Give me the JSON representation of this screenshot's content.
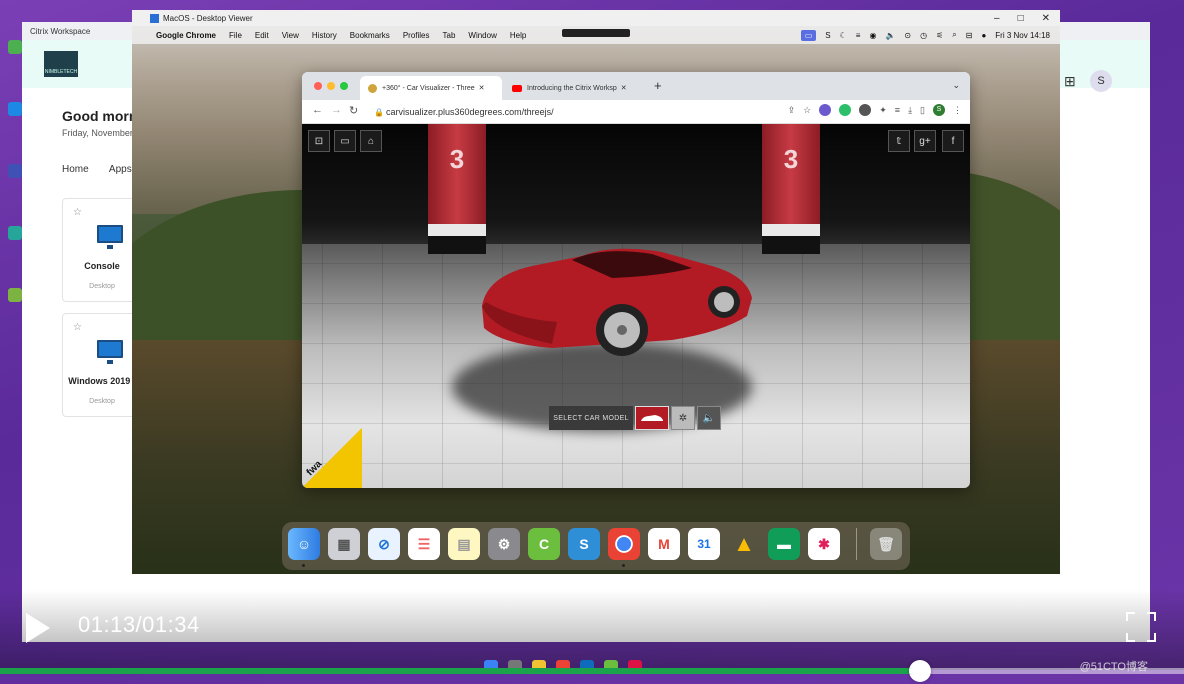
{
  "citrix": {
    "title": "Citrix Workspace",
    "greeting": "Good morn",
    "date": "Friday, November",
    "nav": [
      "Home",
      "Apps"
    ],
    "avatar": "S",
    "logo": "NIMBLETECH",
    "cards": [
      {
        "title": "Console",
        "sub": "Desktop"
      },
      {
        "title": "Windows 2019 -",
        "sub": "Desktop"
      }
    ]
  },
  "viewer": {
    "title": "MacOS - Desktop Viewer",
    "controls": [
      "–",
      "□",
      "✕"
    ]
  },
  "menubar": {
    "app": "Google Chrome",
    "items": [
      "File",
      "Edit",
      "View",
      "History",
      "Bookmarks",
      "Profiles",
      "Tab",
      "Window",
      "Help"
    ],
    "clock": "Fri 3 Nov  14:18"
  },
  "chrome": {
    "tabs": [
      {
        "label": "+360° - Car Visualizer - Three",
        "active": true
      },
      {
        "label": "Introducing the Citrix Worksp",
        "active": false
      }
    ],
    "url": "carvisualizer.plus360degrees.com/threejs/",
    "profile": "S"
  },
  "scene": {
    "pillar_numbers": [
      "3",
      "3"
    ],
    "select_label": "SELECT CAR MODEL",
    "badge": "fwa",
    "social": [
      "𝕥",
      "g+",
      "f"
    ]
  },
  "dock": {
    "apps": [
      "Finder",
      "Launchpad",
      "Safari",
      "Reminders",
      "Notes",
      "System Settings",
      "Citrix",
      "S",
      "Chrome",
      "Gmail",
      "Calendar",
      "Drive",
      "Chat",
      "Slack",
      "Trash"
    ],
    "calendar_day": "31"
  },
  "video": {
    "time": "01:13/01:34",
    "progress": 0.777
  },
  "watermark": "@51CTO博客",
  "colors": {
    "accent": "#1aa34a",
    "car_red": "#b31b24",
    "purple_bg": "#6b35a8"
  }
}
